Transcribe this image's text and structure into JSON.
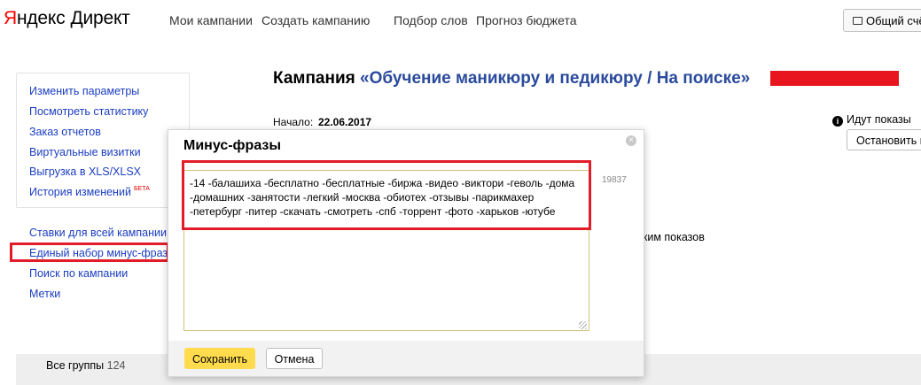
{
  "header": {
    "logo_yandex_first": "Я",
    "logo_yandex_rest": "ндекс",
    "logo_direct": "Директ",
    "nav": [
      "Мои кампании",
      "Создать кампанию",
      "Подбор слов",
      "Прогноз бюджета"
    ],
    "share_button": "Общий счёт"
  },
  "sidebar": {
    "group1": [
      {
        "label": "Изменить параметры"
      },
      {
        "label": "Посмотреть статистику"
      },
      {
        "label": "Заказ отчетов"
      },
      {
        "label": "Виртуальные визитки"
      },
      {
        "label": "Выгрузка в XLS/XLSX"
      },
      {
        "label": "История изменений",
        "badge": "БЕТА"
      }
    ],
    "group2": [
      {
        "label": "Ставки для всей кампании"
      },
      {
        "label": "Единый набор минус-фраз"
      },
      {
        "label": "Поиск по кампании"
      },
      {
        "label": "Метки"
      }
    ]
  },
  "campaign": {
    "title_prefix": "Кампания ",
    "title_quoted": "«Обучение маникюру и педикюру / На поиске»",
    "start_label": "Начало:",
    "start_date": "22.06.2017",
    "status": "Идут показы",
    "stop_button": "Остановить показы",
    "mode_text": "жим показов"
  },
  "groups": {
    "label": "Все группы",
    "count": "124"
  },
  "modal": {
    "title": "Минус-фразы",
    "text": "-14 -балашиха -бесплатно -бесплатные -биржа -видео -виктори -геволь -дома -домашних -занятости -легкий -москва -обиотех -отзывы -парикмахер -петербург -питер -скачать -смотреть -спб -торрент -фото -харьков -ютубе",
    "char_count": "19837",
    "save_button": "Сохранить",
    "cancel_button": "Отмена"
  },
  "colors": {
    "link": "#1a3dc1",
    "highlight": "#e21d2a",
    "save": "#ffdb4d"
  }
}
